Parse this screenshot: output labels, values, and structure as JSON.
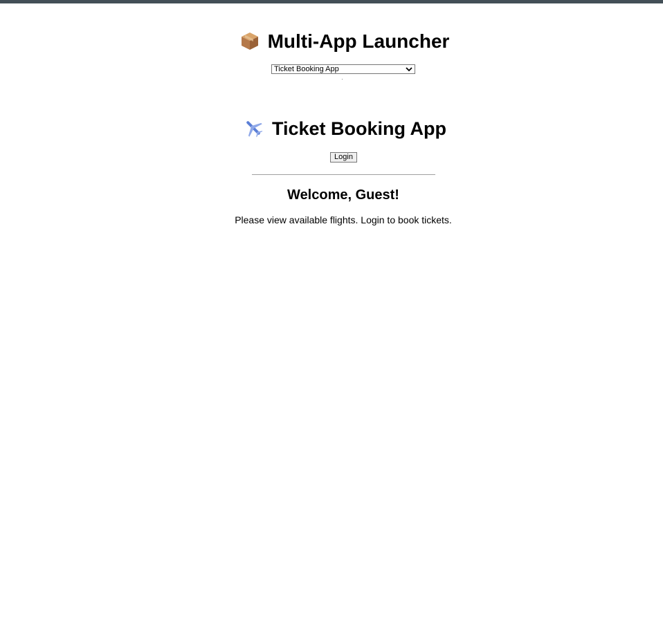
{
  "launcher": {
    "title": "Multi-App Launcher",
    "icon": "package-icon",
    "selected_app": "Ticket Booking App"
  },
  "app": {
    "title": "Ticket Booking App",
    "icon": "airplane-icon",
    "login_label": "Login",
    "welcome": "Welcome, Guest!",
    "message": "Please view available flights. Login to book tickets."
  },
  "colors": {
    "topbar": "#434f57",
    "background": "#ffffff"
  }
}
